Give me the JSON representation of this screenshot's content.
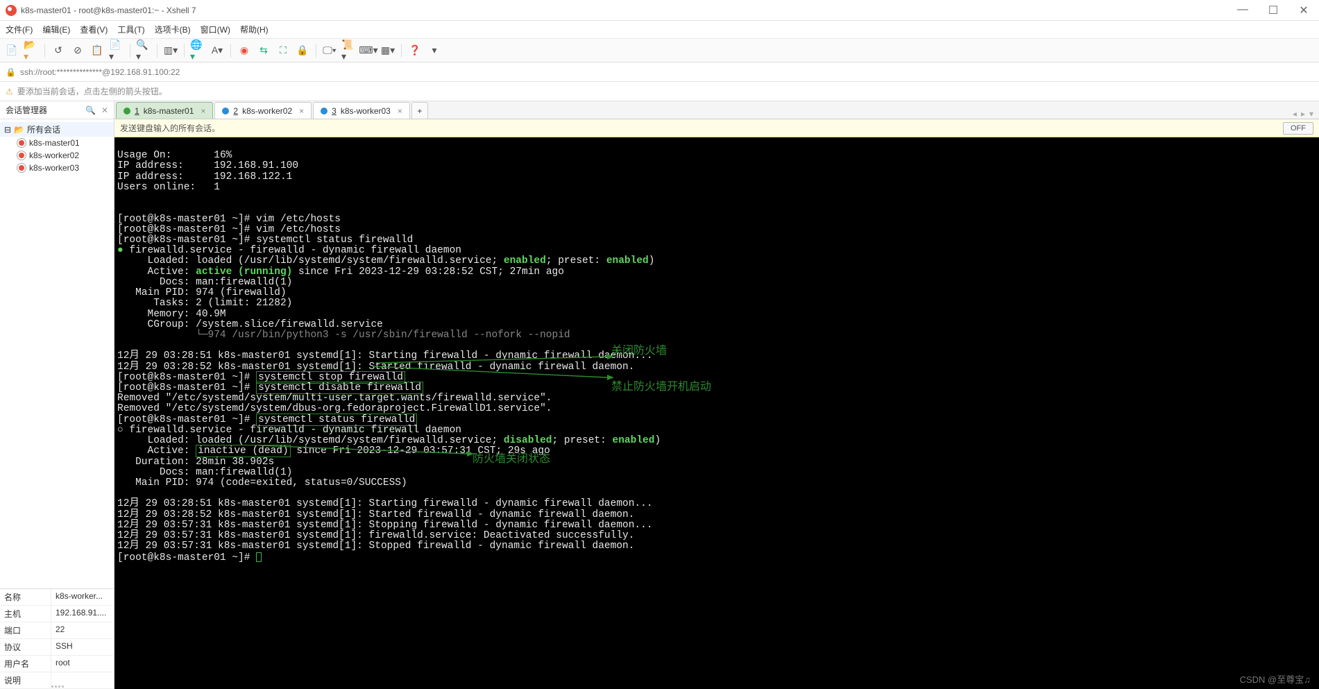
{
  "window": {
    "title": "k8s-master01 - root@k8s-master01:~ - Xshell 7"
  },
  "menubar": {
    "items": [
      "文件(F)",
      "编辑(E)",
      "查看(V)",
      "工具(T)",
      "选项卡(B)",
      "窗口(W)",
      "帮助(H)"
    ]
  },
  "addressbar": {
    "url": "ssh://root:**************@192.168.91.100:22"
  },
  "hintbar": {
    "text": "要添加当前会话，点击左侧的箭头按钮。"
  },
  "sidebar": {
    "title": "会话管理器",
    "root": "所有会话",
    "items": [
      "k8s-master01",
      "k8s-worker02",
      "k8s-worker03"
    ]
  },
  "properties": {
    "rows": [
      {
        "k": "名称",
        "v": "k8s-worker..."
      },
      {
        "k": "主机",
        "v": "192.168.91...."
      },
      {
        "k": "端口",
        "v": "22"
      },
      {
        "k": "协议",
        "v": "SSH"
      },
      {
        "k": "用户名",
        "v": "root"
      },
      {
        "k": "说明",
        "v": ""
      }
    ]
  },
  "tabs": {
    "items": [
      {
        "num": "1",
        "label": "k8s-master01",
        "active": true
      },
      {
        "num": "2",
        "label": "k8s-worker02",
        "active": false
      },
      {
        "num": "3",
        "label": "k8s-worker03",
        "active": false
      }
    ],
    "add": "+"
  },
  "sendbar": {
    "text": "发送键盘输入的所有会话。",
    "off": "OFF"
  },
  "terminal": {
    "usage_label": "Usage On:",
    "usage_val": "16%",
    "ip1_label": "IP address:",
    "ip1_val": "192.168.91.100",
    "ip2_label": "IP address:",
    "ip2_val": "192.168.122.1",
    "users_label": "Users online:",
    "users_val": "1",
    "prompt": "[root@k8s-master01 ~]#",
    "cmd_vim": "vim /etc/hosts",
    "cmd_status": "systemctl status firewalld",
    "svc_line": "firewalld.service - firewalld - dynamic firewall daemon",
    "loaded1": "     Loaded: loaded (/usr/lib/systemd/system/firewalld.service; ",
    "enabled": "enabled",
    "loaded1_tail": "; preset: ",
    "loaded1_tail2": ")",
    "active_label": "     Active: ",
    "active_running": "active (running)",
    "active_tail": " since Fri 2023-12-29 03:28:52 CST; 27min ago",
    "docs": "       Docs: man:firewalld(1)",
    "mainpid": "   Main PID: 974 (firewalld)",
    "tasks": "      Tasks: 2 (limit: 21282)",
    "memory": "     Memory: 40.9M",
    "cgroup": "     CGroup: /system.slice/firewalld.service",
    "cgroup_sub": "             └─974 /usr/bin/python3 -s /usr/sbin/firewalld --nofork --nopid",
    "log_start1": "12月 29 03:28:51 k8s-master01 systemd[1]: Starting firewalld - dynamic firewall daemon...",
    "log_start2": "12月 29 03:28:52 k8s-master01 systemd[1]: Started firewalld - dynamic firewall daemon.",
    "cmd_stop": "systemctl stop firewalld",
    "cmd_disable": "systemctl disable firewalld",
    "removed1": "Removed \"/etc/systemd/system/multi-user.target.wants/firewalld.service\".",
    "removed2": "Removed \"/etc/systemd/system/dbus-org.fedoraproject.FirewallD1.service\".",
    "cmd_status2": "systemctl status firewalld",
    "svc_line2": "○ firewalld.service - firewalld - dynamic firewall daemon",
    "loaded2a": "     Loaded: loaded (/usr/lib/systemd/system/firewalld.service; ",
    "disabled": "disabled",
    "loaded2b": "; preset: ",
    "inactive": "inactive (dead)",
    "active2_tail": " since Fri 2023-12-29 03:57:31 CST; 29s ago",
    "duration": "   Duration: 28min 38.902s",
    "docs2": "       Docs: man:firewalld(1)",
    "mainpid2": "   Main PID: 974 (code=exited, status=0/SUCCESS)",
    "jlog1": "12月 29 03:28:51 k8s-master01 systemd[1]: Starting firewalld - dynamic firewall daemon...",
    "jlog2": "12月 29 03:28:52 k8s-master01 systemd[1]: Started firewalld - dynamic firewall daemon.",
    "jlog3": "12月 29 03:57:31 k8s-master01 systemd[1]: Stopping firewalld - dynamic firewall daemon...",
    "jlog4": "12月 29 03:57:31 k8s-master01 systemd[1]: firewalld.service: Deactivated successfully.",
    "jlog5": "12月 29 03:57:31 k8s-master01 systemd[1]: Stopped firewalld - dynamic firewall daemon."
  },
  "annotations": {
    "a1": "关闭防火墙",
    "a2": "禁止防火墙开机启动",
    "a3": "防火墙关闭状态"
  },
  "watermark": "CSDN @至尊宝♫"
}
